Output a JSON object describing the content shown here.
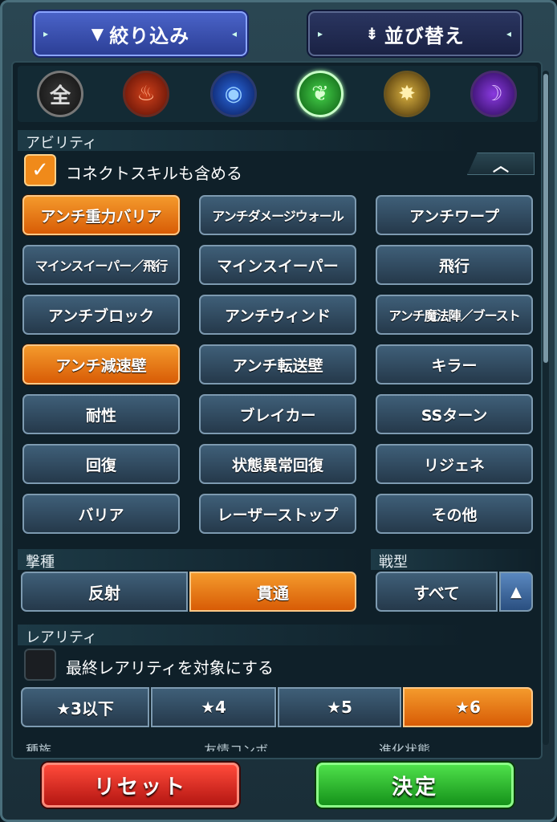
{
  "tabs": {
    "filter_label": "絞り込み",
    "sort_label": "並び替え"
  },
  "elements": [
    {
      "name": "all",
      "glyph": "全"
    },
    {
      "name": "fire",
      "glyph": "♨"
    },
    {
      "name": "water",
      "glyph": "◉"
    },
    {
      "name": "wood",
      "glyph": "❦"
    },
    {
      "name": "light",
      "glyph": "✸"
    },
    {
      "name": "dark",
      "glyph": "☽"
    }
  ],
  "ability": {
    "section_label": "アビリティ",
    "connect_skill_label": "コネクトスキルも含める",
    "connect_skill_checked": true,
    "collapse_icon": "︿",
    "buttons": [
      {
        "label": "アンチ重力バリア",
        "selected": true
      },
      {
        "label": "アンチダメージウォール",
        "selected": false
      },
      {
        "label": "アンチワープ",
        "selected": false
      },
      {
        "label": "マインスイーパー／飛行",
        "selected": false
      },
      {
        "label": "マインスイーパー",
        "selected": false
      },
      {
        "label": "飛行",
        "selected": false
      },
      {
        "label": "アンチブロック",
        "selected": false
      },
      {
        "label": "アンチウィンド",
        "selected": false
      },
      {
        "label": "アンチ魔法陣／ブースト",
        "selected": false
      },
      {
        "label": "アンチ減速壁",
        "selected": true
      },
      {
        "label": "アンチ転送壁",
        "selected": false
      },
      {
        "label": "キラー",
        "selected": false
      },
      {
        "label": "耐性",
        "selected": false
      },
      {
        "label": "ブレイカー",
        "selected": false
      },
      {
        "label": "SSターン",
        "selected": false
      },
      {
        "label": "回復",
        "selected": false
      },
      {
        "label": "状態異常回復",
        "selected": false
      },
      {
        "label": "リジェネ",
        "selected": false
      },
      {
        "label": "バリア",
        "selected": false
      },
      {
        "label": "レーザーストップ",
        "selected": false
      },
      {
        "label": "その他",
        "selected": false
      }
    ]
  },
  "attack_type": {
    "section_label": "撃種",
    "options": [
      "反射",
      "貫通"
    ],
    "selected": "貫通"
  },
  "battle_type": {
    "section_label": "戦型",
    "value": "すべて"
  },
  "rarity": {
    "section_label": "レアリティ",
    "final_rarity_label": "最終レアリティを対象にする",
    "final_rarity_checked": false,
    "options": [
      "★3以下",
      "★4",
      "★5",
      "★6"
    ],
    "selected": "★6"
  },
  "partial_labels": [
    "種族",
    "友情コンボ",
    "進化状態"
  ],
  "footer": {
    "reset_label": "リセット",
    "confirm_label": "決定"
  }
}
